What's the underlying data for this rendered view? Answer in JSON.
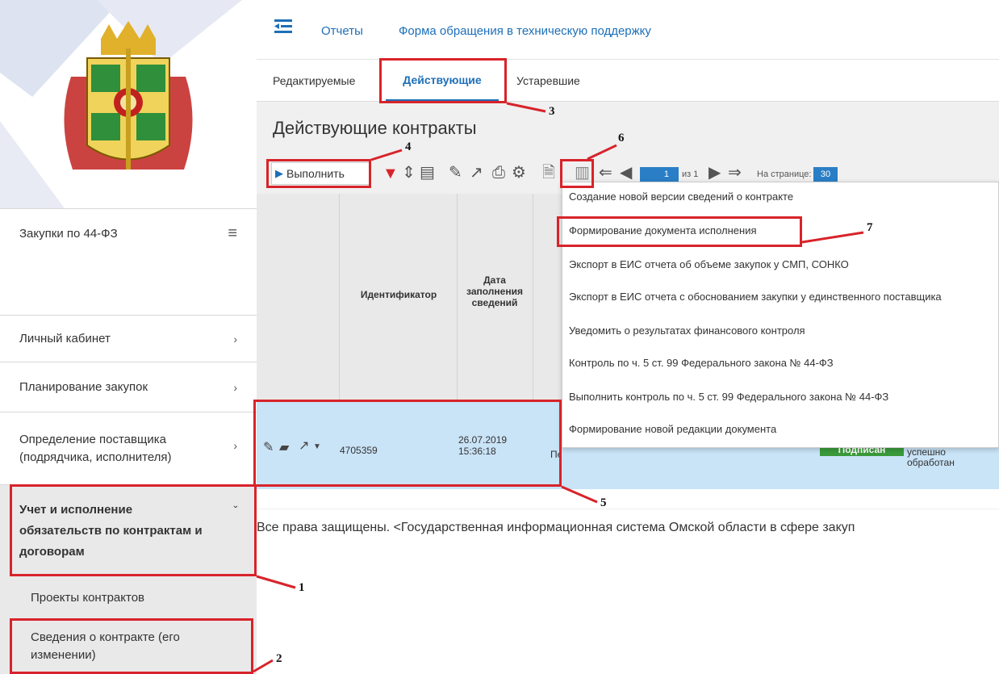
{
  "sidebar": {
    "module_title": "Закупки по 44-ФЗ",
    "items": [
      {
        "label": "Личный кабинет"
      },
      {
        "label": "Планирование закупок"
      },
      {
        "label": "Определение поставщика (подрядчика, исполнителя)"
      },
      {
        "label": "Учет и исполнение обязательств по контрактам и договорам"
      }
    ],
    "sub_items": [
      {
        "label": "Проекты контрактов"
      },
      {
        "label": "Сведения о контракте (его изменении)"
      }
    ]
  },
  "topbar": {
    "links": [
      "Отчеты",
      "Форма обращения в техническую поддержку"
    ]
  },
  "tabs": [
    "Редактируемые",
    "Действующие",
    "Устаревшие"
  ],
  "page_title": "Действующие контракты",
  "toolbar": {
    "execute_label": "Выполнить",
    "page_input": "1",
    "page_of": "из 1",
    "per_page_label": "На странице:",
    "per_page_value": "30"
  },
  "table": {
    "headers": [
      "Идентификатор",
      "Дата заполнения сведений"
    ],
    "row": {
      "id": "4705359",
      "date": "26.07.2019 15:36:18",
      "type_partial": "Первичные",
      "status_badge": "Подписан",
      "result": "успешно обработан"
    }
  },
  "menu": {
    "items": [
      "Создание новой версии сведений о контракте",
      "Формирование документа исполнения",
      "Экспорт в ЕИС отчета об объеме закупок у СМП, СОНКО",
      "Экспорт в ЕИС отчета с обоснованием закупки у единственного поставщика",
      "Уведомить о результатах финансового контроля",
      "Контроль по ч. 5 ст. 99 Федерального закона № 44-ФЗ",
      "Выполнить контроль по ч. 5 ст. 99 Федерального закона № 44-ФЗ",
      "Формирование новой редакции документа"
    ]
  },
  "footer": {
    "text": "Все права защищены. <Государственная информационная система Омской области в сфере закуп"
  },
  "annotations": [
    "1",
    "2",
    "3",
    "4",
    "5",
    "6",
    "7"
  ],
  "colors": {
    "annotation_red": "#d8232a",
    "link_blue": "#1d6fb8",
    "selected_row": "#c9e3f7",
    "badge_green": "#3a9a3a"
  }
}
